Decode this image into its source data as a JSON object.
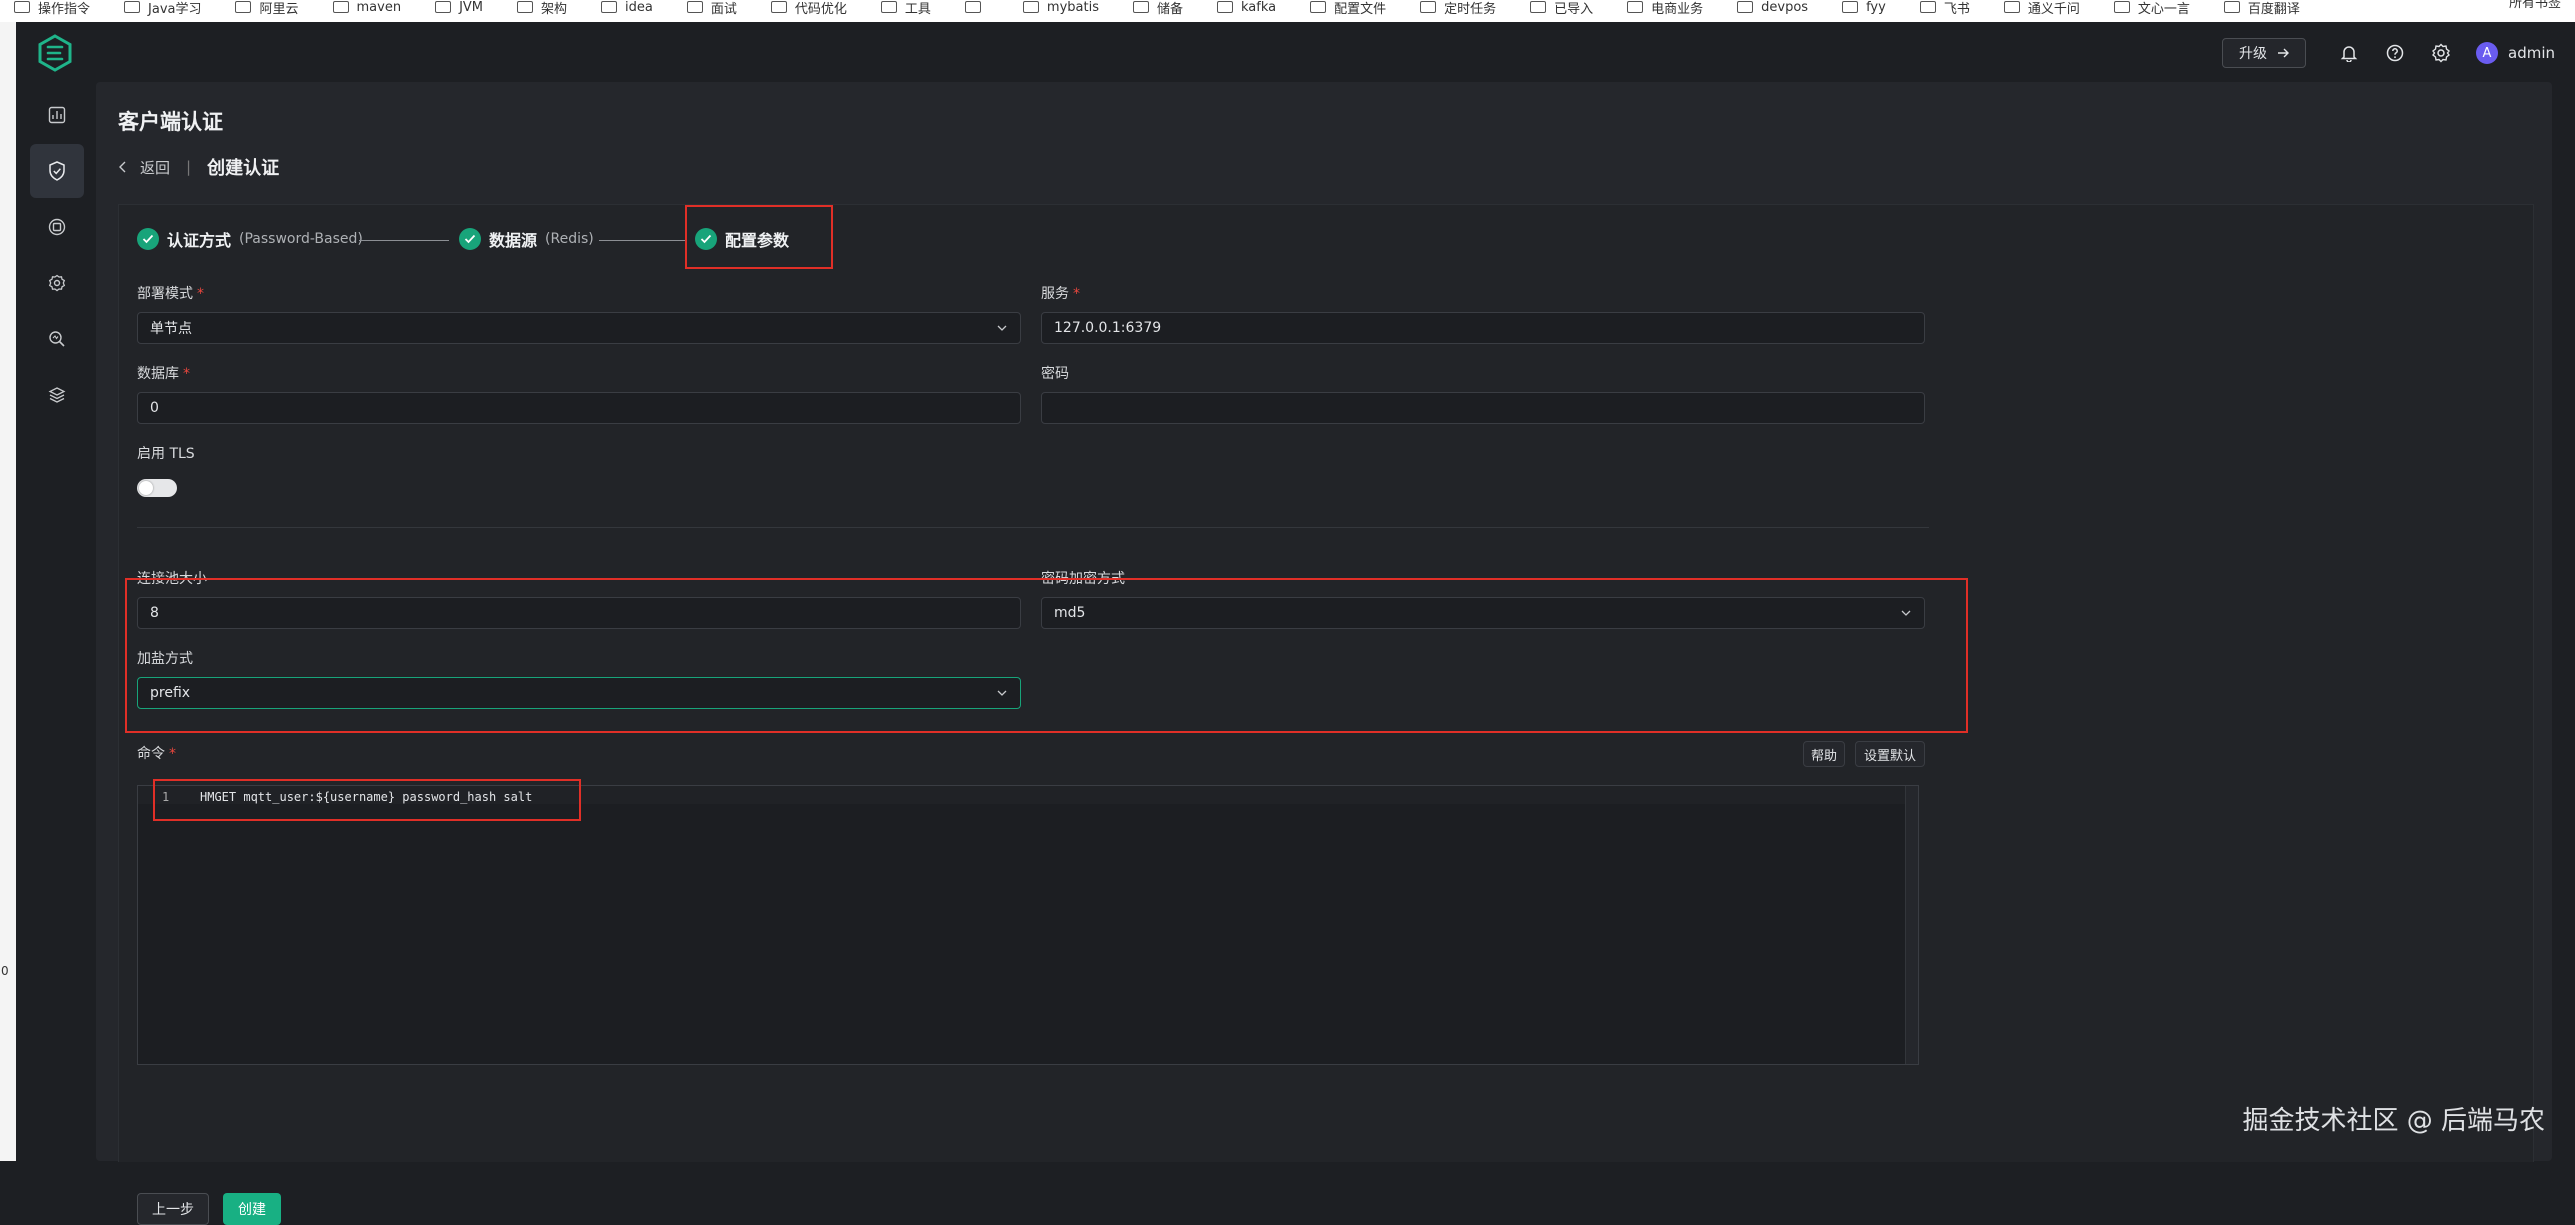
{
  "bookmarks": [
    "操作指令",
    "Java学习",
    "阿里云",
    "maven",
    "JVM",
    "架构",
    "idea",
    "面试",
    "代码优化",
    "工具",
    "",
    "mybatis",
    "储备",
    "kafka",
    "配置文件",
    "定时任务",
    "已导入",
    "电商业务",
    "devpos",
    "fyy",
    "飞书",
    "通义千问",
    "文心一言",
    "百度翻译"
  ],
  "bookmarks_right": "所有书签",
  "left_strip_text": "0",
  "header": {
    "upgrade_label": "升级",
    "user_initial": "A",
    "username": "admin"
  },
  "page": {
    "title": "客户端认证",
    "back_label": "返回",
    "sep": "|",
    "breadcrumb_current": "创建认证"
  },
  "steps": [
    {
      "title": "认证方式",
      "desc": "(Password-Based)"
    },
    {
      "title": "数据源",
      "desc": "(Redis)"
    },
    {
      "title": "配置参数",
      "desc": ""
    }
  ],
  "form": {
    "deploy_mode": {
      "label": "部署模式",
      "value": "单节点",
      "required": "*"
    },
    "server": {
      "label": "服务",
      "value": "127.0.0.1:6379",
      "required": "*"
    },
    "database": {
      "label": "数据库",
      "value": "0",
      "required": "*"
    },
    "password": {
      "label": "密码",
      "value": ""
    },
    "tls": {
      "label": "启用 TLS",
      "enabled": false
    },
    "pool_size": {
      "label": "连接池大小",
      "value": "8"
    },
    "hash_method": {
      "label": "密码加密方式",
      "value": "md5"
    },
    "salt_position": {
      "label": "加盐方式",
      "value": "prefix"
    },
    "command": {
      "label": "命令",
      "required": "*",
      "help_label": "帮助",
      "default_label": "设置默认",
      "line_number": "1",
      "code": "HMGET mqtt_user:${username} password_hash salt"
    }
  },
  "footer": {
    "prev_label": "上一步",
    "create_label": "创建"
  },
  "watermark": "掘金技术社区 @ 后端马农",
  "colors": {
    "accent": "#18b083",
    "highlight_box": "#e02f27",
    "background": "#1d1f23",
    "panel": "#25272c"
  },
  "icons": {
    "sidebar": [
      "dashboard-icon",
      "shield-check-icon",
      "connection-icon",
      "gear-cog-icon",
      "search-diagnose-icon",
      "layers-icon"
    ],
    "header": [
      "bell-icon",
      "help-icon",
      "settings-icon"
    ]
  }
}
